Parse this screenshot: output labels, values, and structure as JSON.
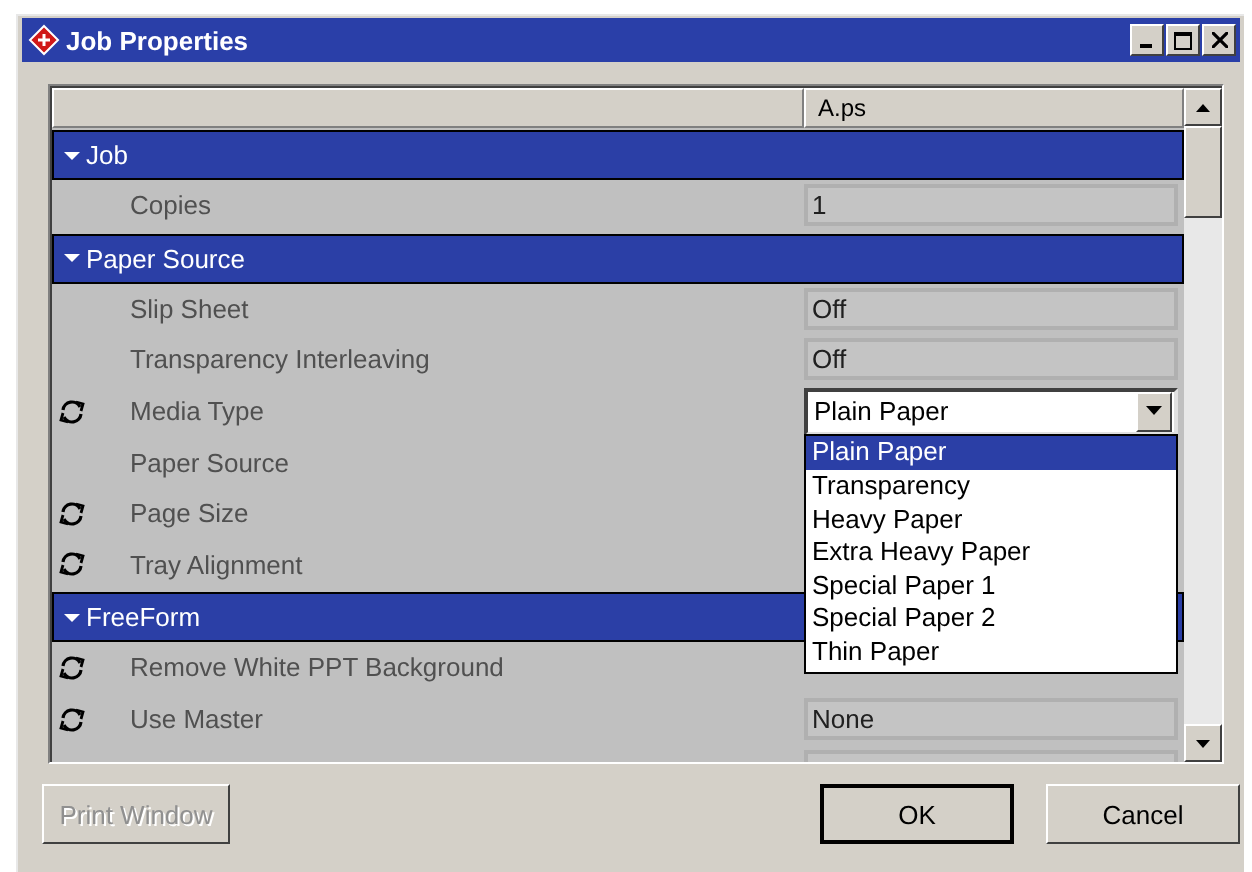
{
  "window": {
    "title": "Job Properties"
  },
  "table": {
    "column_header": "A.ps",
    "groups": [
      {
        "label": "Job",
        "expanded": true,
        "rows": [
          {
            "label": "Copies",
            "refresh_icon": false,
            "kind": "field",
            "value": "1"
          }
        ]
      },
      {
        "label": "Paper Source",
        "expanded": true,
        "rows": [
          {
            "label": "Slip Sheet",
            "refresh_icon": false,
            "kind": "field",
            "value": "Off"
          },
          {
            "label": "Transparency Interleaving",
            "refresh_icon": false,
            "kind": "field",
            "value": "Off"
          },
          {
            "label": "Media Type",
            "refresh_icon": true,
            "kind": "dropdown",
            "value": "Plain Paper",
            "open": true,
            "options": [
              {
                "label": "Plain Paper",
                "selected": true
              },
              {
                "label": "Transparency",
                "selected": false
              },
              {
                "label": "Heavy Paper",
                "selected": false
              },
              {
                "label": "Extra Heavy Paper",
                "selected": false
              },
              {
                "label": "Special Paper 1",
                "selected": false
              },
              {
                "label": "Special Paper 2",
                "selected": false
              },
              {
                "label": "Thin Paper",
                "selected": false
              }
            ]
          },
          {
            "label": "Paper Source",
            "refresh_icon": false
          },
          {
            "label": "Page Size",
            "refresh_icon": true
          },
          {
            "label": "Tray Alignment",
            "refresh_icon": true
          }
        ]
      },
      {
        "label": "FreeForm",
        "expanded": true,
        "rows": [
          {
            "label": "Remove White PPT Background",
            "refresh_icon": true
          },
          {
            "label": "Use Master",
            "refresh_icon": true,
            "kind": "field",
            "value": "None"
          }
        ]
      }
    ]
  },
  "buttons": [
    {
      "label": "Print Window",
      "disabled": true,
      "default": false
    },
    {
      "label": "OK",
      "disabled": false,
      "default": true
    },
    {
      "label": "Cancel",
      "disabled": false,
      "default": false
    }
  ]
}
